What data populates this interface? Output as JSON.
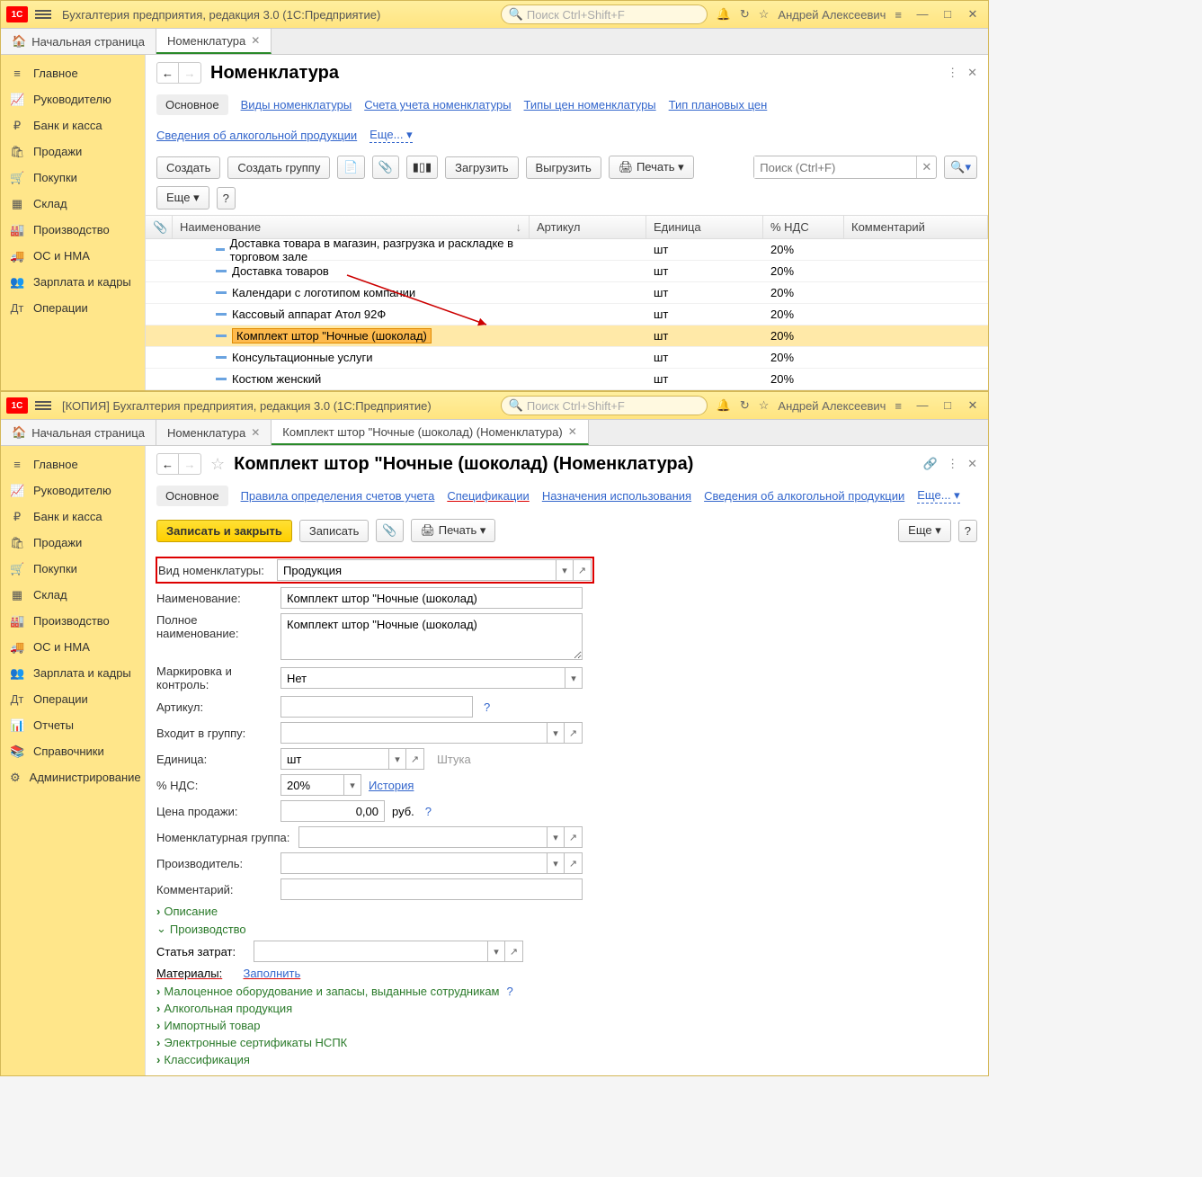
{
  "win1": {
    "title": "Бухгалтерия предприятия, редакция 3.0  (1С:Предприятие)",
    "search_ph": "Поиск Ctrl+Shift+F",
    "user": "Андрей Алексеевич",
    "tabs": {
      "home": "Начальная страница",
      "nom": "Номенклатура"
    },
    "sidebar": [
      "Главное",
      "Руководителю",
      "Банк и касса",
      "Продажи",
      "Покупки",
      "Склад",
      "Производство",
      "ОС и НМА",
      "Зарплата и кадры",
      "Операции"
    ],
    "page_title": "Номенклатура",
    "subnav": {
      "main": "Основное",
      "kinds": "Виды номенклатуры",
      "accounts": "Счета учета номенклатуры",
      "price_types": "Типы цен номенклатуры",
      "plan_types": "Тип плановых цен",
      "alco": "Сведения об алкогольной продукции",
      "more": "Еще..."
    },
    "toolbar": {
      "create": "Создать",
      "create_group": "Создать группу",
      "load": "Загрузить",
      "unload": "Выгрузить",
      "print": "Печать",
      "search_ph": "Поиск (Ctrl+F)",
      "more": "Еще"
    },
    "columns": {
      "name": "Наименование",
      "art": "Артикул",
      "unit": "Единица",
      "nds": "% НДС",
      "comm": "Комментарий"
    },
    "rows": [
      {
        "name": "Доставка товара в магазин, разгрузка и раскладке в торговом зале",
        "unit": "шт",
        "nds": "20%"
      },
      {
        "name": "Доставка товаров",
        "unit": "шт",
        "nds": "20%"
      },
      {
        "name": "Календари с логотипом компании",
        "unit": "шт",
        "nds": "20%"
      },
      {
        "name": "Кассовый аппарат Атол 92Ф",
        "unit": "шт",
        "nds": "20%"
      },
      {
        "name": "Комплект штор \"Ночные (шоколад)",
        "unit": "шт",
        "nds": "20%",
        "selected": true
      },
      {
        "name": "Консультационные услуги",
        "unit": "шт",
        "nds": "20%"
      },
      {
        "name": "Костюм женский",
        "unit": "шт",
        "nds": "20%"
      }
    ]
  },
  "win2": {
    "title": "[КОПИЯ] Бухгалтерия предприятия, редакция 3.0  (1С:Предприятие)",
    "search_ph": "Поиск Ctrl+Shift+F",
    "user": "Андрей Алексеевич",
    "tabs": {
      "home": "Начальная страница",
      "nom": "Номенклатура",
      "item": "Комплект штор \"Ночные (шоколад) (Номенклатура)"
    },
    "sidebar": [
      "Главное",
      "Руководителю",
      "Банк и касса",
      "Продажи",
      "Покупки",
      "Склад",
      "Производство",
      "ОС и НМА",
      "Зарплата и кадры",
      "Операции",
      "Отчеты",
      "Справочники",
      "Администрирование"
    ],
    "page_title": "Комплект штор \"Ночные (шоколад) (Номенклатура)",
    "subnav": {
      "main": "Основное",
      "rules": "Правила определения счетов учета",
      "specs": "Спецификации",
      "assign": "Назначения использования",
      "alco": "Сведения об алкогольной продукции",
      "more": "Еще..."
    },
    "toolbar": {
      "save_close": "Записать и закрыть",
      "save": "Записать",
      "print": "Печать",
      "more": "Еще"
    },
    "form": {
      "kind_label": "Вид номенклатуры:",
      "kind_value": "Продукция",
      "name_label": "Наименование:",
      "name_value": "Комплект штор \"Ночные (шоколад)",
      "full_label": "Полное наименование:",
      "full_value": "Комплект штор \"Ночные (шоколад)",
      "mark_label": "Маркировка и контроль:",
      "mark_value": "Нет",
      "art_label": "Артикул:",
      "group_label": "Входит в группу:",
      "unit_label": "Единица:",
      "unit_value": "шт",
      "unit_hint": "Штука",
      "nds_label": "% НДС:",
      "nds_value": "20%",
      "history": "История",
      "price_label": "Цена продажи:",
      "price_value": "0,00",
      "price_cur": "руб.",
      "nomgroup_label": "Номенклатурная группа:",
      "maker_label": "Производитель:",
      "comment_label": "Комментарий:",
      "desc": "Описание",
      "prod": "Производство",
      "cost_label": "Статья затрат:",
      "materials_label": "Материалы:",
      "fill": "Заполнить",
      "exp1": "Малоценное оборудование и запасы, выданные сотрудникам",
      "exp2": "Алкогольная продукция",
      "exp3": "Импортный товар",
      "exp4": "Электронные сертификаты НСПК",
      "exp5": "Классификация"
    }
  }
}
